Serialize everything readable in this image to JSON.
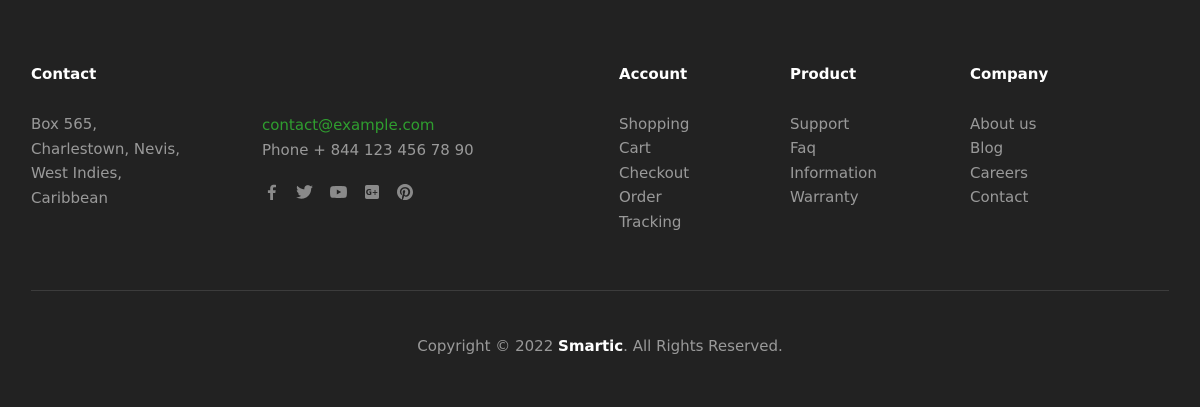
{
  "contact": {
    "title": "Contact",
    "address_lines": [
      "Box 565,",
      "Charlestown, Nevis,",
      "West Indies,",
      "Caribbean"
    ],
    "email": "contact@example.com",
    "phone": "Phone + 844 123 456 78 90",
    "social": [
      {
        "icon": "facebook-icon"
      },
      {
        "icon": "twitter-icon"
      },
      {
        "icon": "youtube-icon"
      },
      {
        "icon": "google-plus-icon"
      },
      {
        "icon": "pinterest-icon"
      }
    ]
  },
  "account": {
    "title": "Account",
    "links": [
      "Shopping",
      "Cart",
      "Checkout",
      "Order",
      "Tracking"
    ]
  },
  "product": {
    "title": "Product",
    "links": [
      "Support",
      "Faq",
      "Information",
      "Warranty"
    ]
  },
  "company": {
    "title": "Company",
    "links": [
      "About us",
      "Blog",
      "Careers",
      "Contact"
    ]
  },
  "copyright": {
    "prefix": "Copyright © 2022 ",
    "brand": "Smartic",
    "suffix": ". All Rights Reserved."
  },
  "colors": {
    "background": "#222222",
    "heading": "#ffffff",
    "text": "#999999",
    "accent": "#2f9e2f",
    "divider": "#3c3c3c"
  }
}
